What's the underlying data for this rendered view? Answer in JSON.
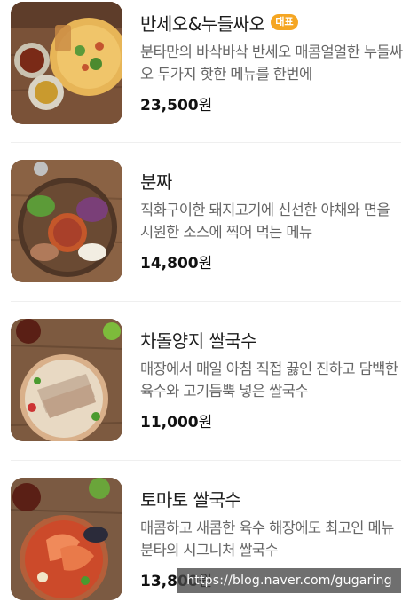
{
  "menu": {
    "items": [
      {
        "name": "반세오&누들싸오",
        "badge": "대표",
        "description": "분타만의 바삭바삭 반세오 매콤얼얼한 누들싸오 두가지 핫한 메뉴를 한번에",
        "price_number": "23,500",
        "price_unit": "원",
        "image": "banh-xeo-dish-photo"
      },
      {
        "name": "분짜",
        "badge": "",
        "description": "직화구이한 돼지고기에 신선한 야채와 면을 시원한 소스에 찍어 먹는 메뉴",
        "price_number": "14,800",
        "price_unit": "원",
        "image": "bun-cha-dish-photo"
      },
      {
        "name": "차돌양지 쌀국수",
        "badge": "",
        "description": "매장에서 매일 아침 직접 끓인 진하고 담백한 육수와 고기듬뿍 넣은 쌀국수",
        "price_number": "11,000",
        "price_unit": "원",
        "image": "brisket-pho-photo"
      },
      {
        "name": "토마토 쌀국수",
        "badge": "",
        "description": "매콤하고 새콤한 육수 해장에도 최고인 메뉴 분타의 시그니처 쌀국수",
        "price_number": "13,800",
        "price_unit": "원",
        "image": "tomato-pho-photo"
      }
    ]
  },
  "watermark": {
    "text": "https://blog.naver.com/gugaring"
  },
  "colors": {
    "badge": "#f5a623",
    "description": "#666666",
    "divider": "#efefef"
  }
}
